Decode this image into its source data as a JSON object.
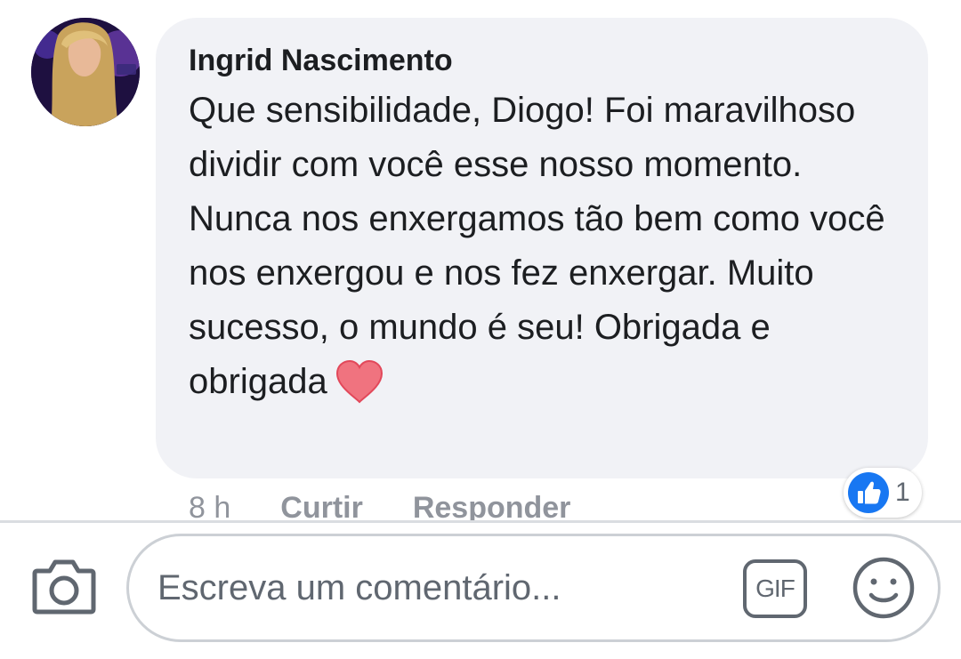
{
  "comment": {
    "author": "Ingrid Nascimento",
    "text": "Que sensibilidade, Diogo! Foi maravilhoso dividir com você esse nosso momento. Nunca nos enxergamos tão bem como você nos enxergou e nos fez enxergar. Muito sucesso, o mundo é seu! Obrigada e obrigada",
    "emoji": "heart-icon",
    "timestamp": "8 h",
    "like_label": "Curtir",
    "reply_label": "Responder",
    "reaction": {
      "icon": "thumbs-up-icon",
      "count": "1"
    }
  },
  "composer": {
    "camera_icon": "camera-icon",
    "placeholder": "Escreva um comentário...",
    "gif_label": "GIF",
    "emoji_icon": "smiley-icon"
  },
  "colors": {
    "bubble_bg": "#f1f2f6",
    "text": "#1c1e21",
    "secondary_text": "#90949c",
    "like_blue": "#1877f2",
    "heart": "#f0737f",
    "divider": "#dadde1"
  }
}
